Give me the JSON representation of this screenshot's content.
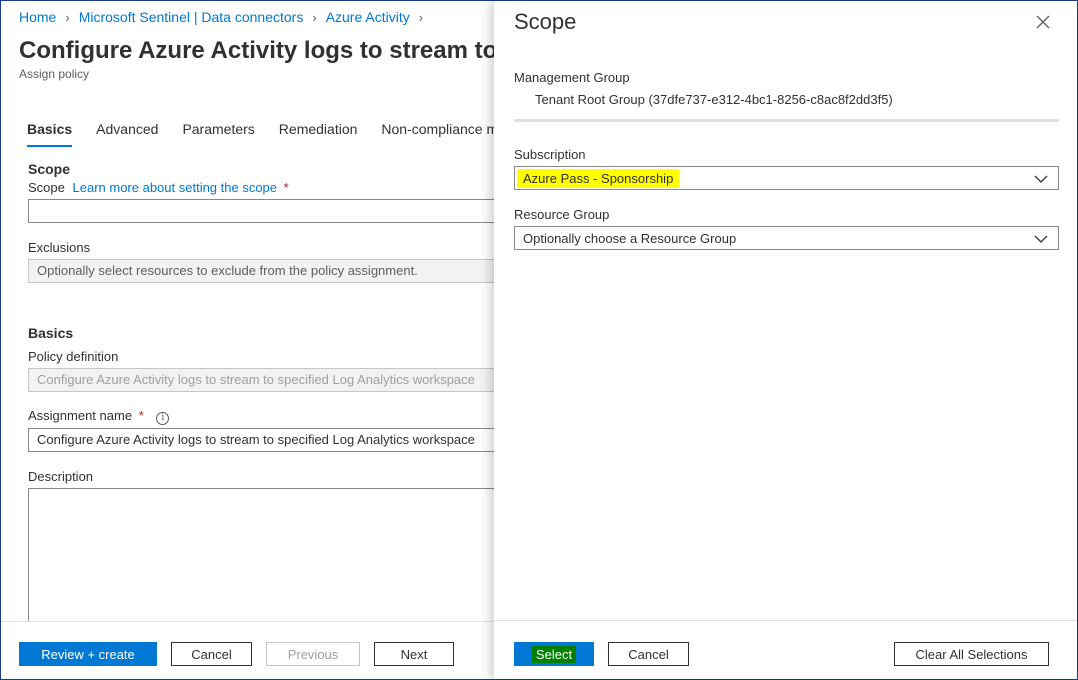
{
  "breadcrumb": {
    "items": [
      "Home",
      "Microsoft Sentinel | Data connectors",
      "Azure Activity"
    ]
  },
  "page": {
    "title": "Configure Azure Activity logs to stream to s",
    "subtitle": "Assign policy"
  },
  "tabs": [
    "Basics",
    "Advanced",
    "Parameters",
    "Remediation",
    "Non-compliance me"
  ],
  "scope_section": {
    "title": "Scope",
    "scope_label": "Scope",
    "scope_link": "Learn more about setting the scope",
    "required_mark": "*",
    "scope_value": "",
    "exclusions_label": "Exclusions",
    "exclusions_value": "Optionally select resources to exclude from the policy assignment."
  },
  "basics_section": {
    "title": "Basics",
    "policy_definition_label": "Policy definition",
    "policy_definition_value": "Configure Azure Activity logs to stream to specified Log Analytics workspace",
    "assignment_name_label": "Assignment name",
    "required_mark": "*",
    "info_glyph": "i",
    "assignment_name_value": "Configure Azure Activity logs to stream to specified Log Analytics workspace",
    "description_label": "Description"
  },
  "footer_left": {
    "review_create": "Review + create",
    "cancel": "Cancel",
    "previous": "Previous",
    "next": "Next"
  },
  "panel": {
    "title": "Scope",
    "management_group_label": "Management Group",
    "management_group_value": "Tenant Root Group (37dfe737-e312-4bc1-8256-c8ac8f2dd3f5)",
    "subscription_label": "Subscription",
    "subscription_value": "Azure Pass - Sponsorship",
    "resource_group_label": "Resource Group",
    "resource_group_value": "Optionally choose a Resource Group",
    "select": "Select",
    "cancel": "Cancel",
    "clear_all": "Clear All Selections"
  },
  "colors": {
    "accent": "#0078d4",
    "highlight_yellow": "#ffff00",
    "highlight_green": "#008000"
  }
}
